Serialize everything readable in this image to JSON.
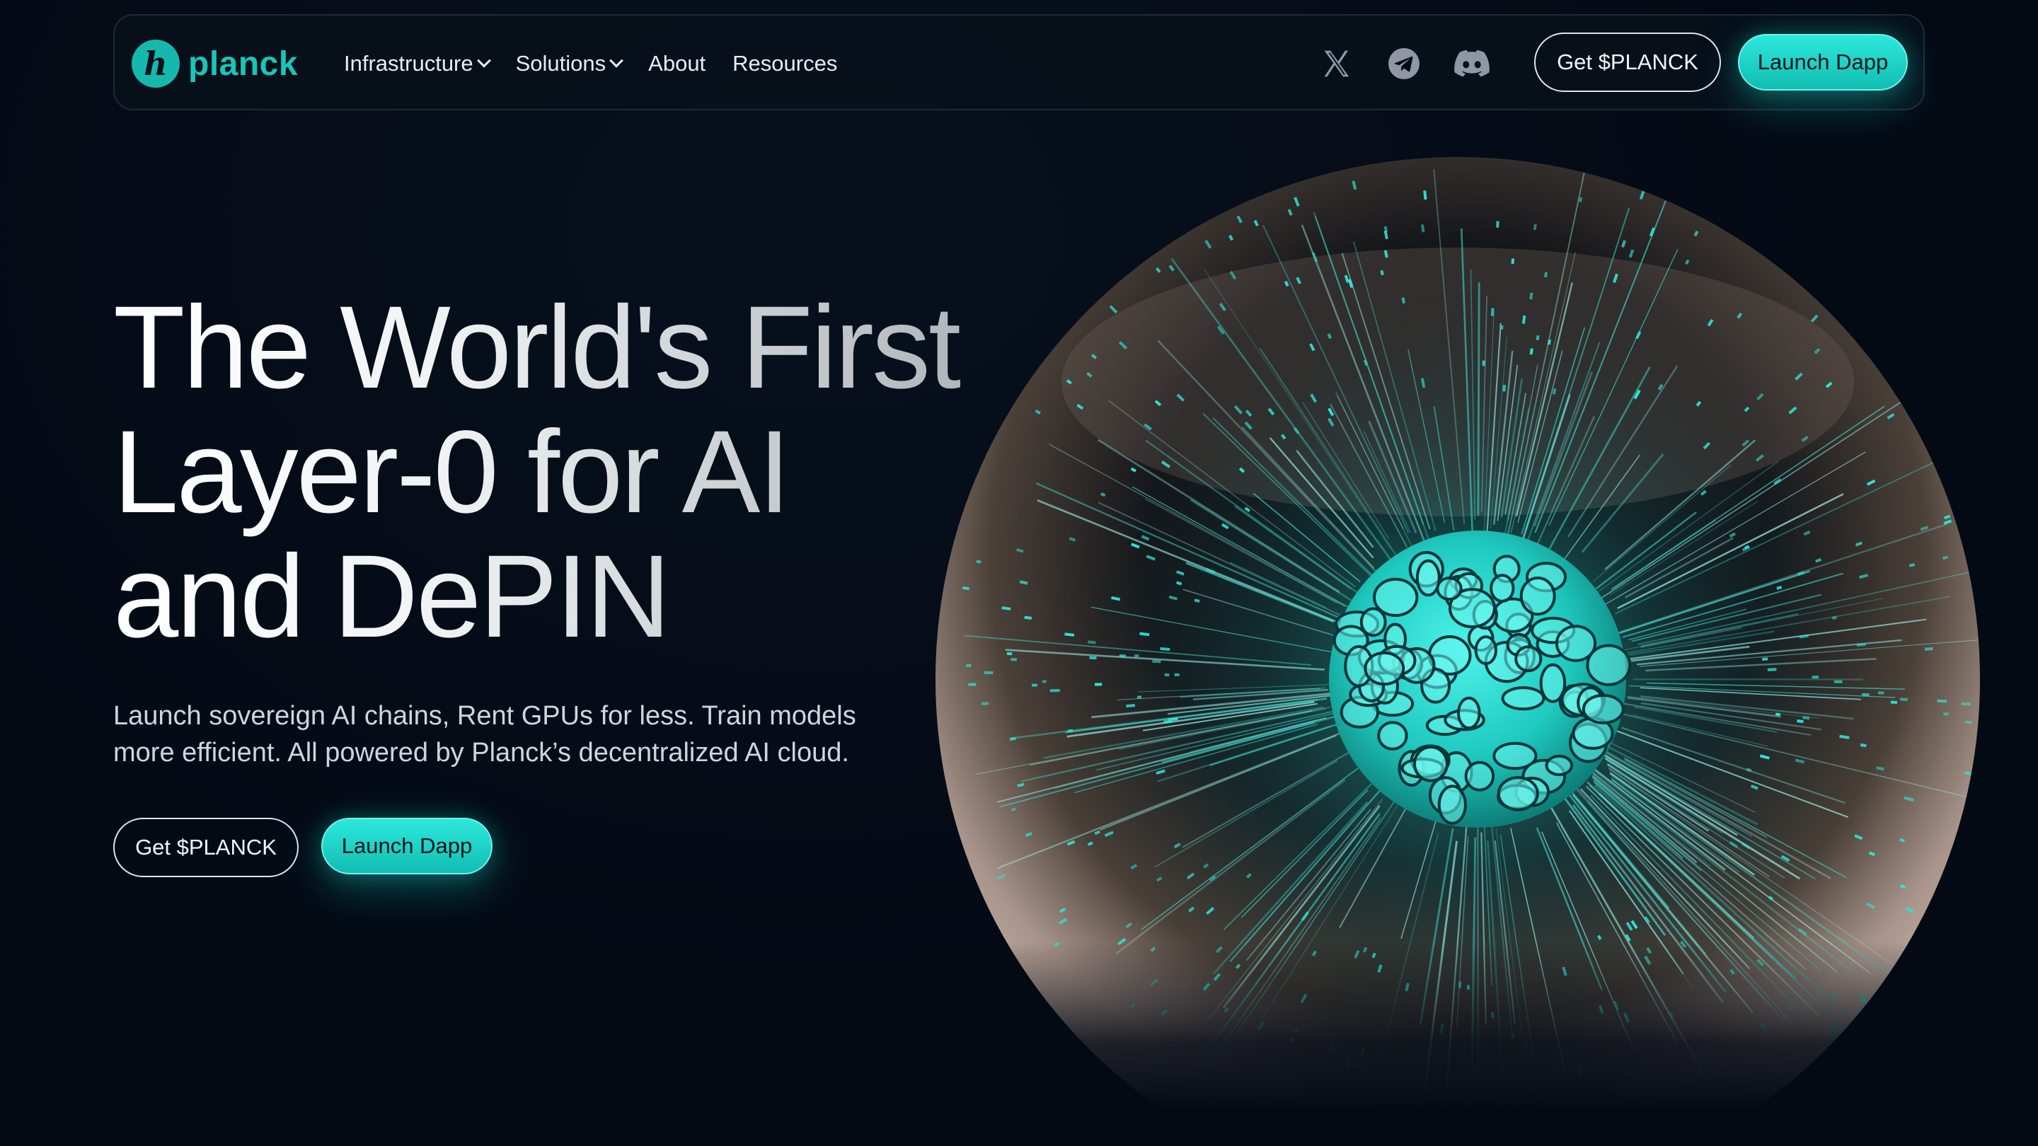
{
  "brand": {
    "name": "planck",
    "mark": "h",
    "color": "#17c6b9"
  },
  "nav": {
    "items": [
      {
        "label": "Infrastructure",
        "has_dropdown": true
      },
      {
        "label": "Solutions",
        "has_dropdown": true
      },
      {
        "label": "About",
        "has_dropdown": false
      },
      {
        "label": "Resources",
        "has_dropdown": false
      }
    ],
    "socials": [
      "x-icon",
      "telegram-icon",
      "discord-icon"
    ],
    "get_token_label": "Get $PLANCK",
    "launch_label": "Launch Dapp"
  },
  "hero": {
    "headline_lines": [
      "The World's First",
      "Layer-0 for AI",
      "and DePIN"
    ],
    "subtitle_lines": [
      "Launch sovereign AI chains, Rent GPUs for less. Train models",
      "more efficient. All powered by Planck’s decentralized AI cloud."
    ],
    "get_token_label": "Get $PLANCK",
    "launch_label": "Launch Dapp"
  },
  "colors": {
    "accent": "#17c6b9",
    "background": "#040a14",
    "text": "#ffffff"
  }
}
